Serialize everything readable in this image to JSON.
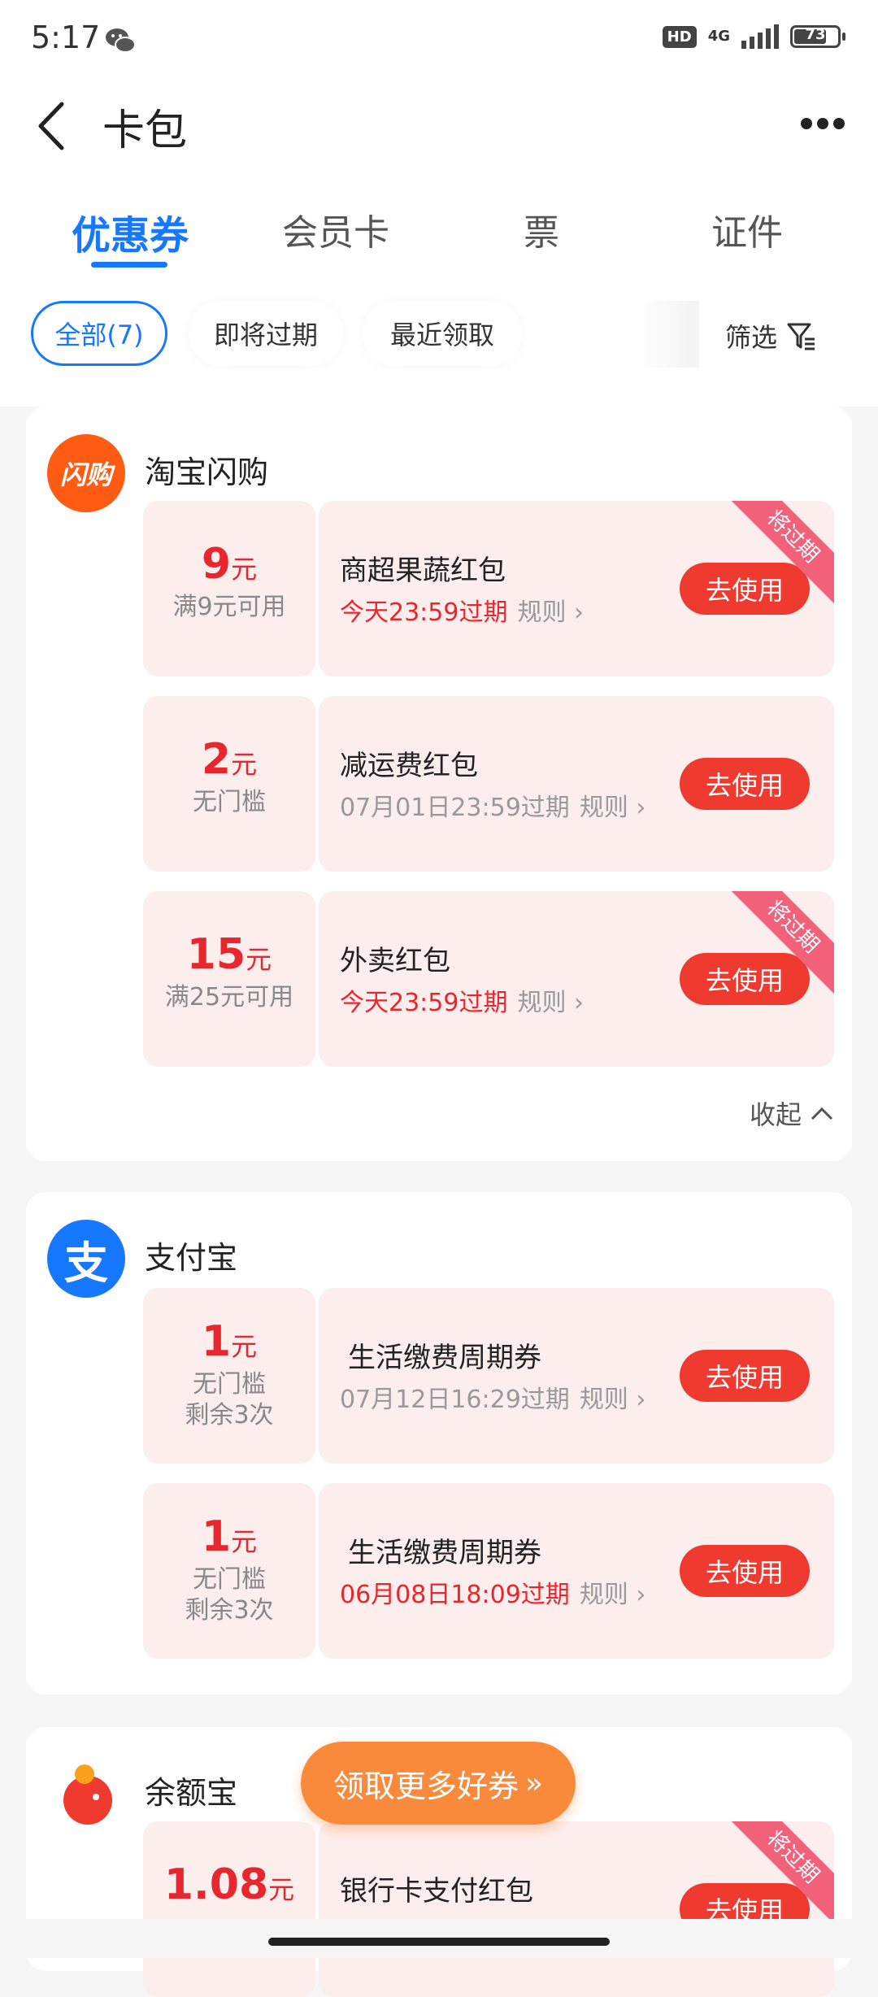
{
  "status_bar": {
    "time": "5:17",
    "network": "4G",
    "hd": "HD",
    "battery": "73"
  },
  "header": {
    "title": "卡包"
  },
  "tabs": [
    {
      "label": "优惠券",
      "active": true
    },
    {
      "label": "会员卡",
      "active": false
    },
    {
      "label": "票",
      "active": false
    },
    {
      "label": "证件",
      "active": false
    }
  ],
  "filters": {
    "chips": [
      "全部(7)",
      "即将过期",
      "最近领取"
    ],
    "filter_label": "筛选"
  },
  "groups": [
    {
      "merchant": "淘宝闪购",
      "logo_text": "闪购",
      "coupons": [
        {
          "amount": "9",
          "unit": "元",
          "condition": "满9元可用",
          "name": "商超果蔬红包",
          "expiry": "今天23:59过期",
          "rule": "规则",
          "button": "去使用",
          "ribbon": "将过期"
        },
        {
          "amount": "2",
          "unit": "元",
          "condition": "无门槛",
          "name": "减运费红包",
          "expiry": "07月01日23:59过期",
          "rule": "规则",
          "button": "去使用"
        },
        {
          "amount": "15",
          "unit": "元",
          "condition": "满25元可用",
          "name": "外卖红包",
          "expiry": "今天23:59过期",
          "rule": "规则",
          "button": "去使用",
          "ribbon": "将过期"
        }
      ],
      "collapse": "收起"
    },
    {
      "merchant": "支付宝",
      "logo_text": "支",
      "coupons": [
        {
          "amount": "1",
          "unit": "元",
          "condition": "无门槛",
          "condition2": "剩余3次",
          "name": "生活缴费周期券",
          "expiry": "07月12日16:29过期",
          "rule": "规则",
          "button": "去使用"
        },
        {
          "amount": "1",
          "unit": "元",
          "condition": "无门槛",
          "condition2": "剩余3次",
          "name": "生活缴费周期券",
          "expiry": "06月08日18:09过期",
          "rule": "规则",
          "button": "去使用"
        }
      ]
    },
    {
      "merchant": "余额宝",
      "coupons": [
        {
          "amount": "1.08",
          "unit": "元",
          "name": "银行卡支付红包",
          "button": "去使用",
          "ribbon": "将过期"
        }
      ]
    }
  ],
  "float_button": "领取更多好券",
  "colors": {
    "accent": "#1677ff",
    "red": "#e8262d",
    "button": "#ee3a2f",
    "orange": "#f98a3c"
  }
}
